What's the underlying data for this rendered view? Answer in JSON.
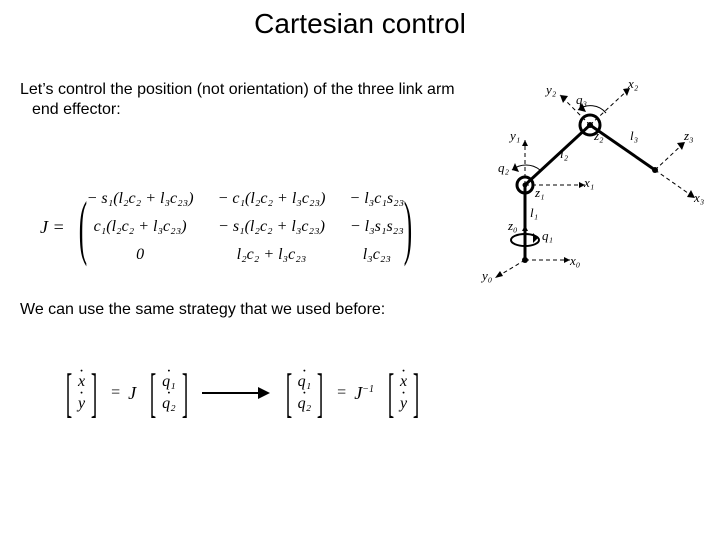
{
  "title": "Cartesian control",
  "para1": "Let’s control the position (not orientation) of the three link arm end effector:",
  "para2": "We can use the same strategy that we used before:",
  "J": {
    "lead": "J =",
    "r1c1": "− s₁(l₂c₂ + l₃c₂₃)",
    "r1c2": "− c₁(l₂c₂ + l₃c₂₃)",
    "r1c3": "− l₃c₁s₂₃",
    "r2c1": "c₁(l₂c₂ + l₃c₂₃)",
    "r2c2": "− s₁(l₂c₂ + l₃c₂₃)",
    "r2c3": "− l₃s₁s₂₃",
    "r3c1": "0",
    "r3c2": "l₂c₂ + l₃c₂₃",
    "r3c3": "l₃c₂₃"
  },
  "eq": {
    "x": "x",
    "y": "y",
    "q1": "q₁",
    "q2": "q₂",
    "eqsym": "=",
    "J": "J",
    "Jinv_sup": "−1"
  },
  "diagram": {
    "x0": "x₀",
    "y0": "y₀",
    "z0": "z₀",
    "q1": "q₁",
    "l1": "l₁",
    "x1": "x₁",
    "y1": "y₁",
    "z1": "z₁",
    "q2": "q₂",
    "l2": "l₂",
    "x2": "x₂",
    "y2": "y₂",
    "z2": "z₂",
    "q3": "q₃",
    "l3": "l₃",
    "x3": "x₃",
    "z3": "z₃"
  }
}
